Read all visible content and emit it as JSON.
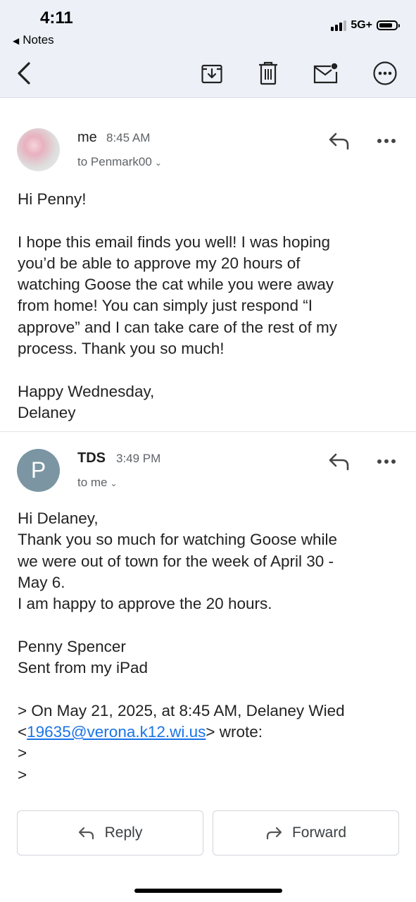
{
  "status_bar": {
    "time": "4:11",
    "back_app": "Notes",
    "network": "5G+"
  },
  "toolbar": {
    "back_icon": "chevron-left-icon",
    "archive_icon": "archive-icon",
    "delete_icon": "trash-icon",
    "mark_unread_icon": "mail-unread-icon",
    "more_icon": "more-circle-icon"
  },
  "messages": [
    {
      "sender": "me",
      "time": "8:45 AM",
      "to": "to Penmark00",
      "avatar": "photo",
      "body": [
        "Hi Penny!",
        "",
        "I hope this email finds you well! I was hoping",
        "you’d be able to approve my 20 hours of",
        "watching Goose the cat while you were away",
        "from home! You can simply just respond “I",
        "approve” and I can take care of the rest of my",
        "process. Thank you so much!",
        "",
        "Happy Wednesday,",
        "Delaney"
      ]
    },
    {
      "sender": "TDS",
      "time": "3:49 PM",
      "to": "to me",
      "avatar_letter": "P",
      "avatar_color": "#7b95a3",
      "body": [
        "Hi Delaney,",
        "Thank you so much for watching Goose while",
        "we were out of town for the week of April 30 -",
        "May 6.",
        "I am happy to approve the 20 hours.",
        "",
        "Penny Spencer",
        "Sent from my iPad",
        ""
      ],
      "quote_prefix": "> On May 21, 2025, at 8:45 AM, Delaney Wied",
      "quote_lt": "<",
      "quote_email": "19635@verona.k12.wi.us",
      "quote_suffix": "> wrote:",
      "quote_lines": [
        ">",
        ">"
      ]
    }
  ],
  "actions": {
    "reply": "Reply",
    "forward": "Forward"
  }
}
